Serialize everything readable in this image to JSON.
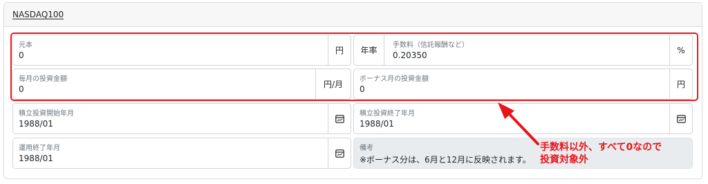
{
  "card": {
    "title": "NASDAQ100"
  },
  "fields": {
    "principal": {
      "label": "元本",
      "value": "0",
      "unit": "円"
    },
    "fee": {
      "prefix": "年率",
      "label": "手数料（信託報酬など）",
      "value": "0.20350",
      "unit": "%"
    },
    "monthly": {
      "label": "毎月の投資金額",
      "value": "0",
      "unit": "円/月"
    },
    "bonus": {
      "label": "ボーナス月の投資金額",
      "value": "0",
      "unit": "円"
    },
    "start": {
      "label": "積立投資開始年月",
      "value": "1988/01"
    },
    "end": {
      "label": "積立投資終了年月",
      "value": "1988/01"
    },
    "operation_end": {
      "label": "運用終了年月",
      "value": "1988/01"
    },
    "note": {
      "label": "備考",
      "value": "※ボーナス分は、6月と12月に反映されます。"
    }
  },
  "annotation": {
    "line1": "手数料以外、すべて0なので",
    "line2": "投資対象外",
    "color": "#e8151b"
  },
  "icons": {
    "calendar": "calendar-icon"
  }
}
